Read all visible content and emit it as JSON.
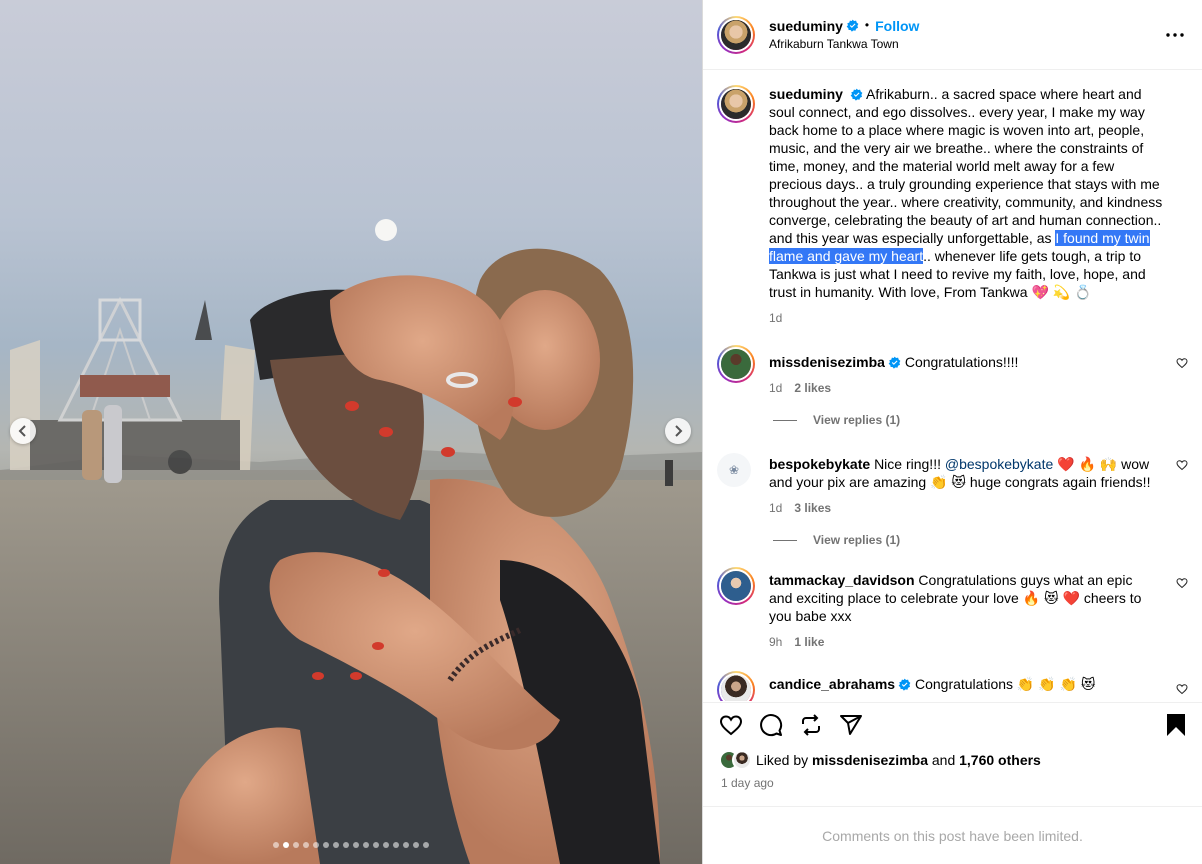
{
  "post": {
    "username": "sueduminy",
    "follow_label": "Follow",
    "separator": "•",
    "location": "Afrikaburn Tankwa Town",
    "more_label": "···"
  },
  "caption": {
    "username": "sueduminy",
    "text_before": "Afrikaburn.. a sacred space where heart and soul connect, and ego dissolves.. every year, I make my way back home to a place where magic is woven into art, people, music, and the very air we breathe.. where the constraints of time, money, and the material world melt away for a few precious days.. a truly grounding experience that stays with me throughout the year.. where creativity, community, and kindness converge, celebrating the beauty of art and human connection.. and this year was especially unforgettable, as ",
    "highlighted": "I found my twin flame and gave my heart",
    "text_after": ".. whenever life gets tough, a trip to Tankwa is just what I need to revive my faith, love, hope, and trust in humanity. With love, From Tankwa 💖 💫 💍",
    "time": "1d"
  },
  "comments": [
    {
      "username": "missdenisezimba",
      "verified": true,
      "text": "Congratulations!!!!",
      "time": "1d",
      "likes": "2 likes",
      "replies": "View replies (1)"
    },
    {
      "username": "bespokebykate",
      "verified": false,
      "text_before": "Nice ring!!! ",
      "mention": "@bespokebykate",
      "text_after": " ❤️ 🔥 🙌 wow and your pix are amazing 👏 😻 huge congrats again friends!!",
      "time": "1d",
      "likes": "3 likes",
      "replies": "View replies (1)"
    },
    {
      "username": "tammackay_davidson",
      "verified": false,
      "text": "Congratulations guys what an epic and exciting place to celebrate your love 🔥 😻 ❤️ cheers to you babe xxx",
      "time": "9h",
      "likes": "1 like"
    },
    {
      "username": "candice_abrahams",
      "verified": true,
      "text": "Congratulations 👏 👏 👏 😻"
    }
  ],
  "likes": {
    "prefix": "Liked by ",
    "user": "missdenisezimba",
    "middle": " and ",
    "count": "1,760 others"
  },
  "time_ago": "1 day ago",
  "comments_limited": "Comments on this post have been limited.",
  "carousel": {
    "total": 16,
    "active_index": 1
  },
  "colors": {
    "accent": "#0095f6",
    "highlight": "#3478f6",
    "muted": "#737373"
  }
}
